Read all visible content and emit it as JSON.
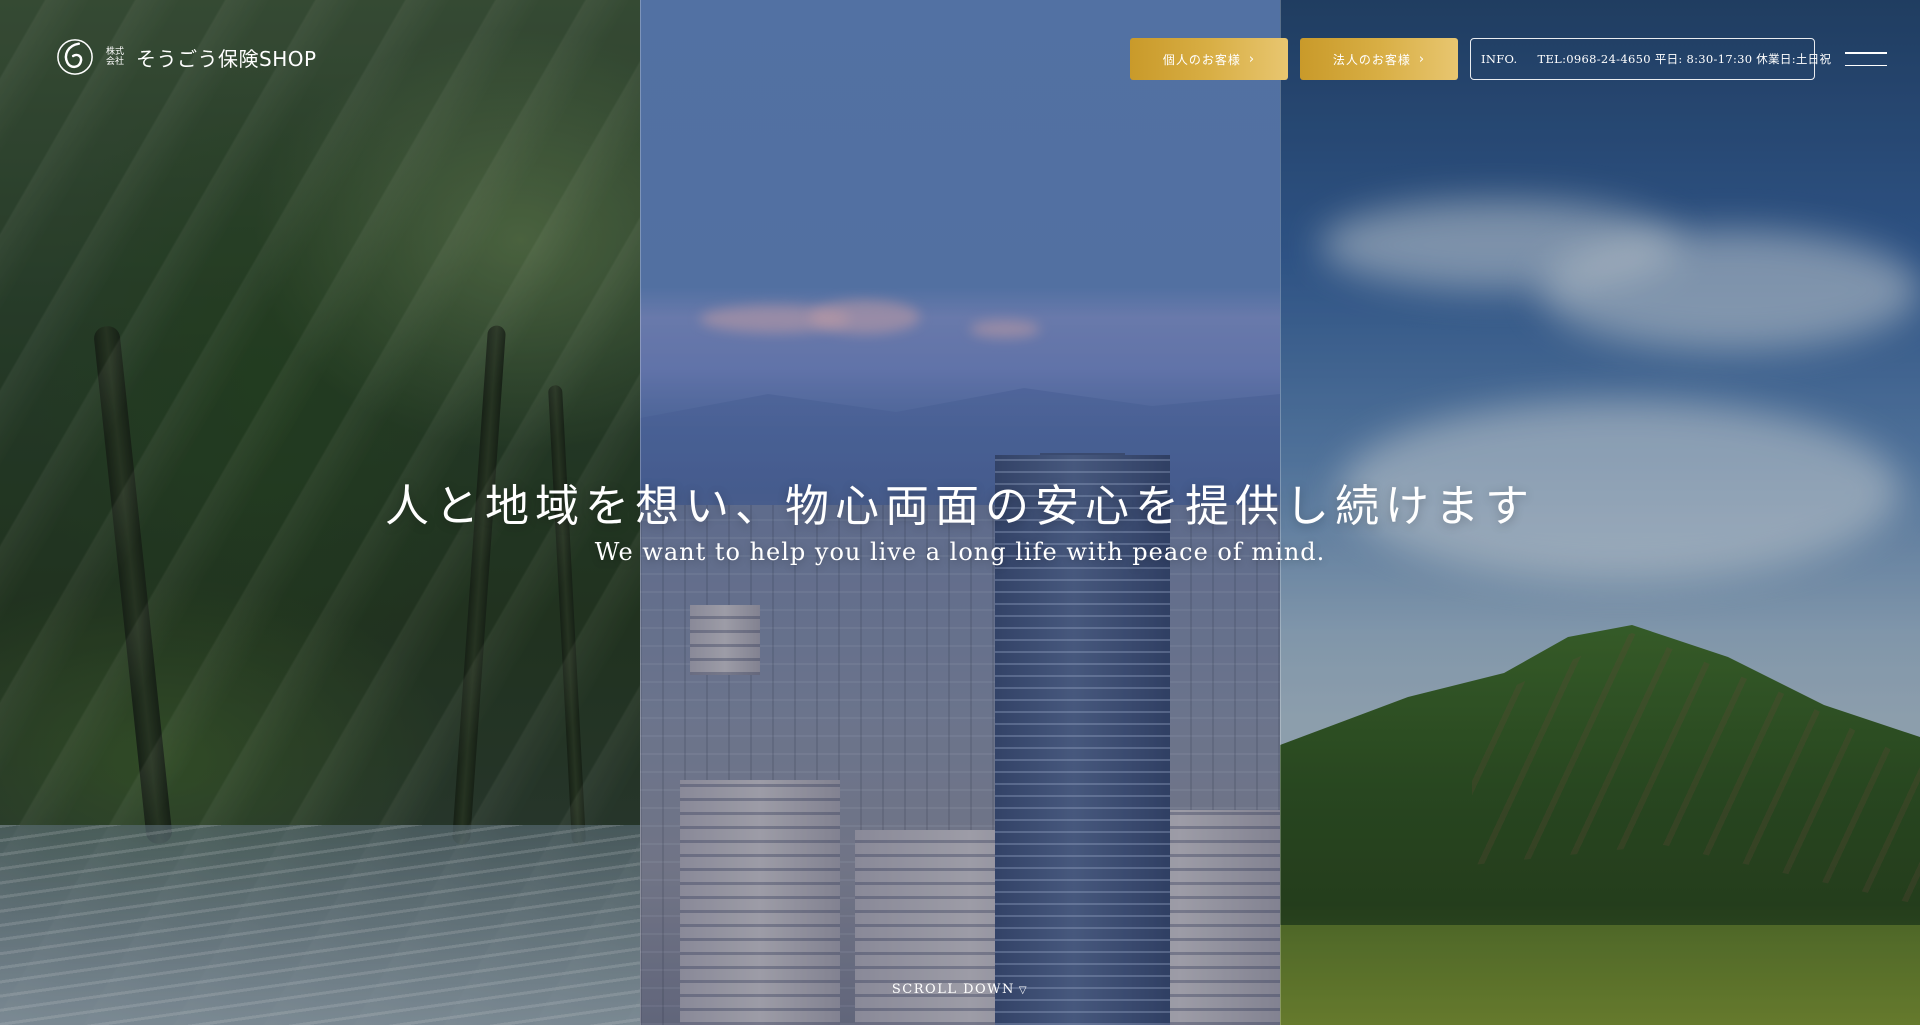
{
  "header": {
    "logo_prefix_top": "株式",
    "logo_prefix_bottom": "会社",
    "logo_name": "そうごう保険SHOP",
    "logo_icon": "swirl-logo-icon",
    "buttons": [
      {
        "label": "個人のお客様",
        "icon": "chevron-right-icon"
      },
      {
        "label": "法人のお客様",
        "icon": "chevron-right-icon"
      }
    ],
    "info": {
      "label": "INFO.",
      "text": "TEL:0968-24-4650 平日: 8:30-17:30 休業日:土日祝"
    },
    "menu_icon": "hamburger-menu-icon"
  },
  "hero": {
    "headline": "人と地域を想い、物心両面の安心を提供し続けます",
    "subline": "We want to help you live a long life with peace of mind.",
    "scroll_label": "SCROLL DOWN",
    "scroll_icon": "triangle-down-icon",
    "panels": [
      "forest",
      "city",
      "mountain"
    ]
  },
  "colors": {
    "gold_start": "#c99a2a",
    "gold_end": "#e8c670",
    "text": "#ffffff"
  }
}
